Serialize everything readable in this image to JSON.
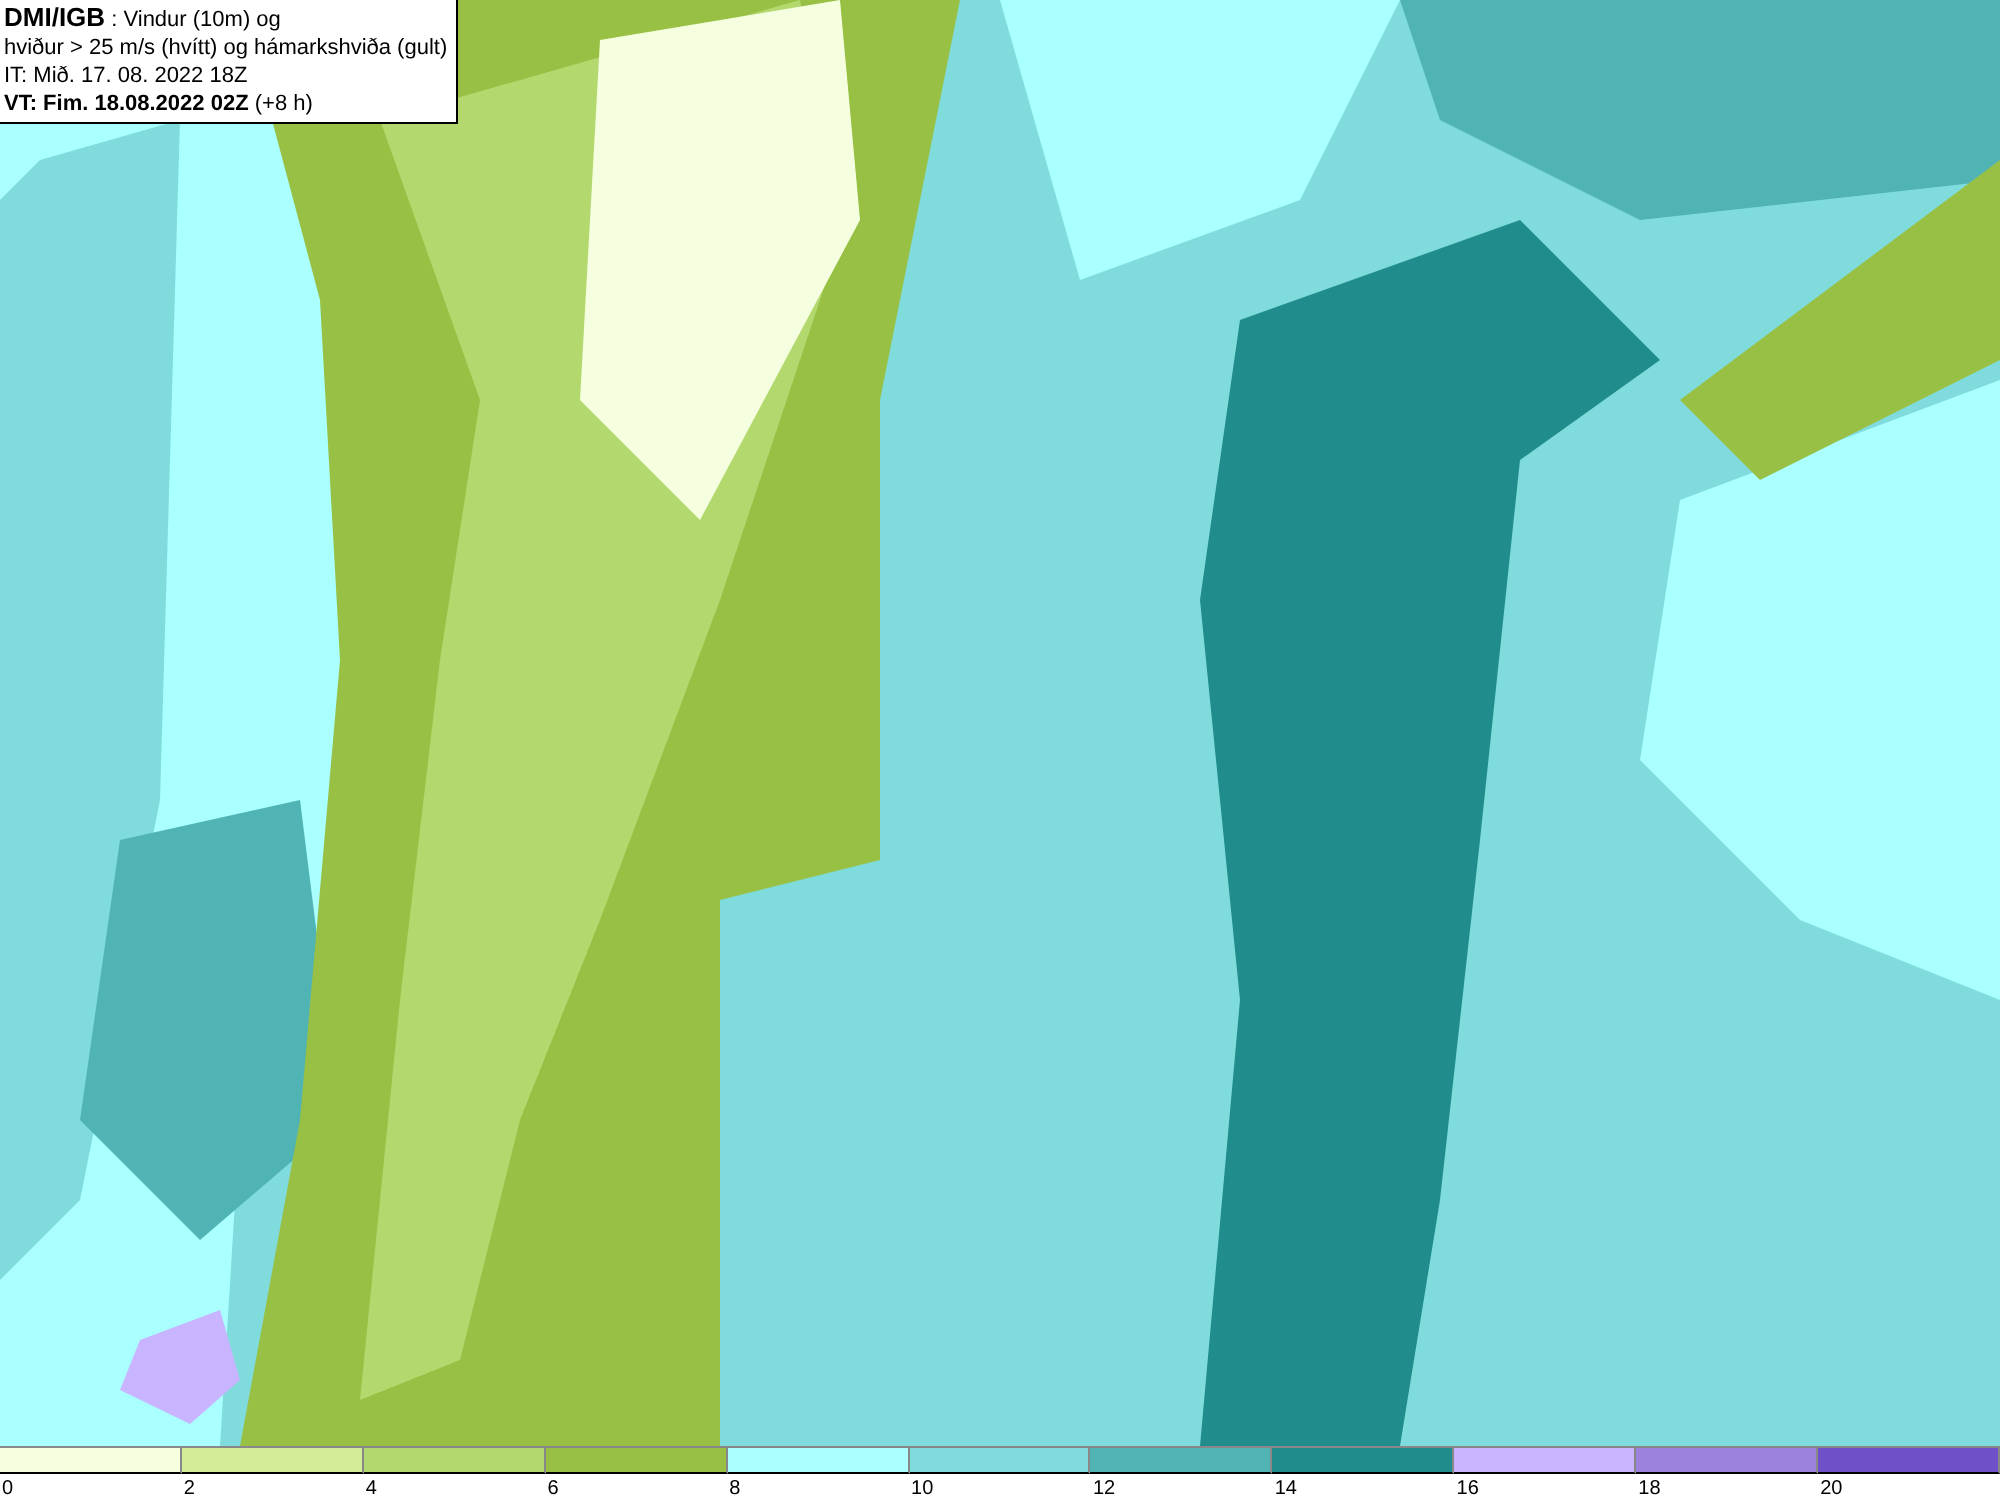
{
  "info_box": {
    "lines": [
      "**DMI/IGB** : Vindur (10m) og",
      "hviður > 25 m/s (hvítt) og hámarkshviða (gult)",
      "IT: Mið. 17. 08. 2022 18Z",
      "**VT: Fim. 18.08.2022 02Z** (+8 h)"
    ]
  },
  "legend": {
    "bins": [
      {
        "color": "#f5ffe0",
        "tick": "0"
      },
      {
        "color": "#d4ec96",
        "tick": "2"
      },
      {
        "color": "#b3d86e",
        "tick": "4"
      },
      {
        "color": "#98c044",
        "tick": "6"
      },
      {
        "color": "#aaffff",
        "tick": "8"
      },
      {
        "color": "#80dcdc",
        "tick": "10"
      },
      {
        "color": "#50b4b4",
        "tick": "12"
      },
      {
        "color": "#208c8c",
        "tick": "14"
      },
      {
        "color": "#c8b4ff",
        "tick": "16"
      },
      {
        "color": "#9b82dc",
        "tick": "18"
      },
      {
        "color": "#6e50c8",
        "tick": "20"
      }
    ]
  }
}
